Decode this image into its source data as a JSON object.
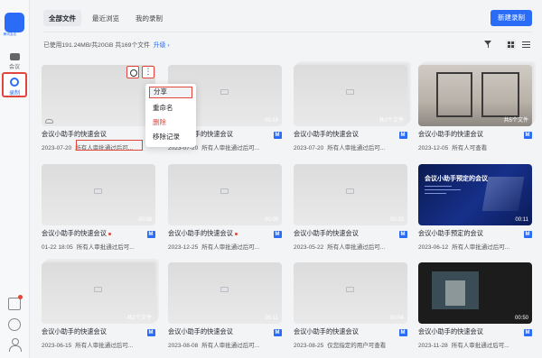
{
  "logo_sub": "腾讯会议",
  "sidebar": {
    "meeting_label": "会议",
    "record_label": "录制"
  },
  "tabs": [
    "全部文件",
    "最近浏览",
    "我的录制"
  ],
  "new_button": "新建录制",
  "storage_text": "已使用191.24MB/共20GB  共169个文件",
  "upgrade": "升级",
  "menu": {
    "share": "分享",
    "rename": "重命名",
    "delete": "删除",
    "remove": "移除记录"
  },
  "cards": [
    {
      "title": "会议小助手的快速会议",
      "date": "2023-07-20",
      "perm": "所有人审批通过后可...",
      "dur": ""
    },
    {
      "title": "会议小助手的快速会议",
      "date": "2023-07-20",
      "perm": "所有人审批通过后可...",
      "dur": "00:18"
    },
    {
      "title": "会议小助手的快速会议",
      "date": "2023-07-20",
      "perm": "所有人审批通过后可...",
      "dur": "共2个文件"
    },
    {
      "title": "会议小助手的快速会议",
      "date": "2023-12-05",
      "perm": "所有人可查看",
      "dur": "共5个文件"
    },
    {
      "title": "会议小助手的快速会议",
      "date": "01-22 18:05",
      "perm": "所有人审批通过后可...",
      "dur": "00:08"
    },
    {
      "title": "会议小助手的快速会议",
      "date": "2023-12-25",
      "perm": "所有人审批通过后可...",
      "dur": "00:09"
    },
    {
      "title": "会议小助手的快速会议",
      "date": "2023-05-22",
      "perm": "所有人审批通过后可...",
      "dur": "00:15"
    },
    {
      "title": "会议小助手预定的会议",
      "date": "2023-06-12",
      "perm": "所有人审批通过后可...",
      "dur": "00:11",
      "thumb_text": "会议小助手预定的会议"
    },
    {
      "title": "会议小助手的快速会议",
      "date": "2023-06-15",
      "perm": "所有人审批通过后可...",
      "dur": "共2个文件"
    },
    {
      "title": "会议小助手的快速会议",
      "date": "2023-08-08",
      "perm": "所有人审批通过后可...",
      "dur": "05:11"
    },
    {
      "title": "会议小助手的快速会议",
      "date": "2023-08-25",
      "perm": "仅您指定的用户可查看",
      "dur": "00:04"
    },
    {
      "title": "会议小助手的快速会议",
      "date": "2023-11-28",
      "perm": "所有人审批通过后可...",
      "dur": "00:50"
    }
  ],
  "colors": {
    "accent": "#2b6cf6",
    "highlight": "#e0463c"
  }
}
